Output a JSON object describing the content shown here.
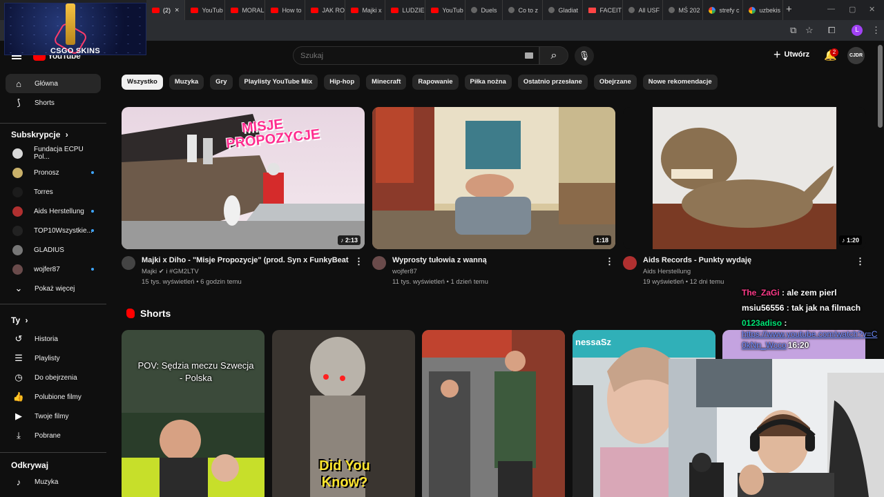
{
  "browser": {
    "tabs": [
      {
        "label": "(2)",
        "fav": "yt",
        "active": true
      },
      {
        "label": "YouTub",
        "fav": "yt"
      },
      {
        "label": "MORAL",
        "fav": "yt"
      },
      {
        "label": "How to",
        "fav": "yt"
      },
      {
        "label": "JAK RO",
        "fav": "yt"
      },
      {
        "label": "Majki x",
        "fav": "yt"
      },
      {
        "label": "LUDZIE",
        "fav": "yt"
      },
      {
        "label": "YouTub",
        "fav": "yt"
      },
      {
        "label": "Duels",
        "fav": "pin"
      },
      {
        "label": "Co to z",
        "fav": "dark"
      },
      {
        "label": "Gladiat",
        "fav": "dark"
      },
      {
        "label": "FACEIT",
        "fav": "x"
      },
      {
        "label": "All USF",
        "fav": "dark"
      },
      {
        "label": "MŚ 202",
        "fav": "dark"
      },
      {
        "label": "strefy c",
        "fav": "g"
      },
      {
        "label": "uzbekis",
        "fav": "g"
      }
    ],
    "close_glyph": "×",
    "new_tab_glyph": "+",
    "profile_letter": "L"
  },
  "overlay": {
    "csgo_label": "CSGO SKINS"
  },
  "masthead": {
    "logo_text": "YouTube",
    "search_placeholder": "Szukaj",
    "create_label": "Utwórz",
    "notification_count": "2",
    "account_initials": "CJDR"
  },
  "sidebar": {
    "main": [
      {
        "label": "Główna",
        "icon": "home-icon",
        "active": true
      },
      {
        "label": "Shorts",
        "icon": "shorts-icon"
      }
    ],
    "subscriptions_title": "Subskrypcje",
    "subscriptions": [
      {
        "label": "Fundacja ECPU Pol...",
        "color": "#d8d8d8",
        "dot": false
      },
      {
        "label": "Pronosz",
        "color": "#c9b16a",
        "dot": true
      },
      {
        "label": "Torres",
        "color": "#1c1c1c",
        "dot": false
      },
      {
        "label": "Aids Herstellung",
        "color": "#b03030",
        "dot": true
      },
      {
        "label": "TOP10Wszystkie...",
        "color": "#222222",
        "dot": true
      },
      {
        "label": "GLADIUS",
        "color": "#777777",
        "dot": false
      },
      {
        "label": "wojfer87",
        "color": "#6a4b4b",
        "dot": true
      }
    ],
    "show_more": "Pokaż więcej",
    "you_title": "Ty",
    "you_items": [
      {
        "label": "Historia",
        "icon": "history-icon"
      },
      {
        "label": "Playlisty",
        "icon": "playlists-icon"
      },
      {
        "label": "Do obejrzenia",
        "icon": "watch-later-icon"
      },
      {
        "label": "Polubione filmy",
        "icon": "like-icon"
      },
      {
        "label": "Twoje filmy",
        "icon": "your-videos-icon"
      },
      {
        "label": "Pobrane",
        "icon": "download-icon"
      }
    ],
    "explore_title": "Odkrywaj",
    "explore_items": [
      {
        "label": "Muzyka",
        "icon": "music-icon"
      }
    ]
  },
  "chips": [
    "Wszystko",
    "Muzyka",
    "Gry",
    "Playlisty YouTube Mix",
    "Hip-hop",
    "Minecraft",
    "Rapowanie",
    "Piłka nożna",
    "Ostatnio przesłane",
    "Obejrzane",
    "Nowe rekomendacje"
  ],
  "videos": [
    {
      "title": "Majki x Diho - \"Misje Propozycje\" (prod. Syn x FunkyBeatz)",
      "channel": "Majki ✔ i #GM2LTV",
      "stats": "15 tys. wyświetleń • 6 godzin temu",
      "duration": "♪ 2:13",
      "thumb_text": "MISJE PROPOZYCJE"
    },
    {
      "title": "Wyprosty tułowia z wanną",
      "channel": "wojfer87",
      "stats": "11 tys. wyświetleń • 1 dzień temu",
      "duration": "1:18"
    },
    {
      "title": "Aids Records - Punkty wydaję",
      "channel": "Aids Herstellung",
      "stats": "19 wyświetleń • 12 dni temu",
      "duration": "♪ 1:20"
    }
  ],
  "shorts": {
    "title": "Shorts",
    "items": [
      {
        "overlay_text": "POV: Sędzia meczu Szwecja - Polska"
      },
      {
        "overlay_text": "Did You Know?"
      },
      {
        "overlay_text": ""
      },
      {
        "overlay_text": "nessaSz"
      }
    ]
  },
  "chat": [
    {
      "user": "The_ZaGi",
      "text": ": ale zem pierl",
      "cls": "u1"
    },
    {
      "user": "msiu56556",
      "text": ": tak jak na filmach",
      "cls": "u2"
    },
    {
      "user": "0123adiso",
      "text": ":",
      "cls": "u3",
      "link": "https://www.youtube.com/watch?v=C0kNn_Wcco",
      "time": "16:20"
    }
  ]
}
